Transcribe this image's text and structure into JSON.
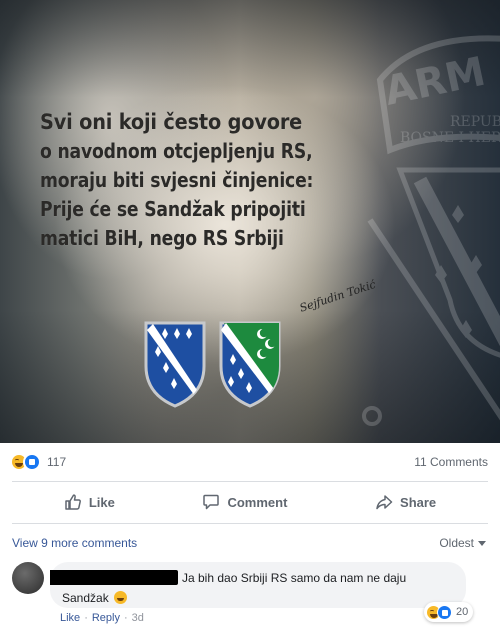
{
  "post": {
    "image": {
      "text_lines": [
        "Svi oni koji često govore",
        "o navodnom otcjepljenju RS,",
        "moraju biti svjesni činjenice:",
        "Prije će se Sandžak pripojiti",
        "matici BiH, nego RS Srbiji"
      ],
      "signature": "Sejfudin Tokić",
      "logo_text": {
        "big": "ARM",
        "line1": "REPUB",
        "line2": "BOSNE I HER"
      },
      "shields": [
        "bih-flag-shield",
        "sandzak-flag-shield"
      ]
    },
    "reactions": {
      "icons": [
        "haha-icon",
        "like-icon"
      ],
      "count": "117"
    },
    "comments_count": "11 Comments",
    "actions": {
      "like": "Like",
      "comment": "Comment",
      "share": "Share"
    }
  },
  "comments_section": {
    "view_more": "View 9 more comments",
    "sort": "Oldest",
    "items": [
      {
        "author": "",
        "text_line1": "Ja bih dao Srbiji RS samo da nam ne daju",
        "text_line2": "Sandžak",
        "reaction_count": "20",
        "like_label": "Like",
        "reply_label": "Reply",
        "separator": "·",
        "time": "3d"
      }
    ]
  },
  "colors": {
    "link": "#385898",
    "secondary": "#606770",
    "like_blue": "#1877f2",
    "haha_yellow": "#f7b928",
    "bubble_bg": "#f2f3f5"
  }
}
